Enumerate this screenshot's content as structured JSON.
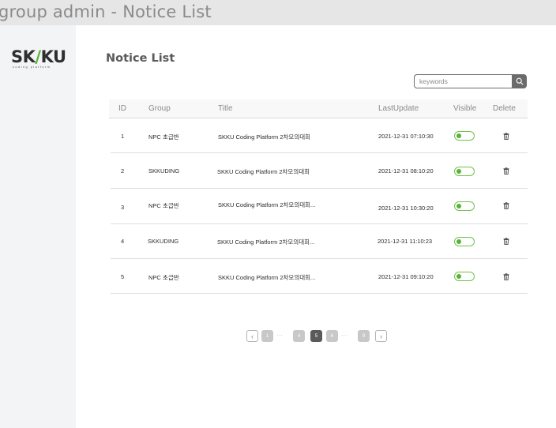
{
  "window": {
    "title": "group admin - Notice List"
  },
  "logo": {
    "text_left": "SK",
    "text_slash": "/",
    "text_right": "KU",
    "subtitle": "coding platform"
  },
  "page": {
    "title": "Notice List"
  },
  "search": {
    "placeholder": "keywords",
    "icon": "search-icon"
  },
  "table": {
    "headers": {
      "id": "ID",
      "group": "Group",
      "title": "Title",
      "last_update": "LastUpdate",
      "visible": "Visible",
      "delete": "Delete"
    },
    "rows": [
      {
        "id": "1",
        "group": "NPC 초급반",
        "title": "SKKU Coding Platform 2차모의대회",
        "last_update": "2021-12-31 07:10:30",
        "visible": true
      },
      {
        "id": "2",
        "group": "SKKUDING",
        "title": "SKKU Coding Platform 2차모의대회",
        "last_update": "2021-12-31 08:10:20",
        "visible": true
      },
      {
        "id": "3",
        "group": "NPC 초급반",
        "title": "SKKU Coding Platform 2차모의대회...",
        "last_update": "2021-12-31 10:30:20",
        "visible": true
      },
      {
        "id": "4",
        "group": "SKKUDING",
        "title": "SKKU Coding Platform 2차모의대회...",
        "last_update": "2021-12-31 11:10:23",
        "visible": true
      },
      {
        "id": "5",
        "group": "NPC 초급반",
        "title": "SKKU Coding Platform 2차모의대회...",
        "last_update": "2021-12-31 09:10:20",
        "visible": true
      }
    ]
  },
  "pagination": {
    "prev": "‹",
    "next": "›",
    "ellipsis": "···",
    "pages": [
      "1",
      "4",
      "5",
      "6",
      "9"
    ],
    "current": "5"
  },
  "colors": {
    "accent": "#5bb33a",
    "toggle_border": "#6fc24b",
    "active_page": "#5a5a5a",
    "inactive_page": "#c8c8c8"
  }
}
